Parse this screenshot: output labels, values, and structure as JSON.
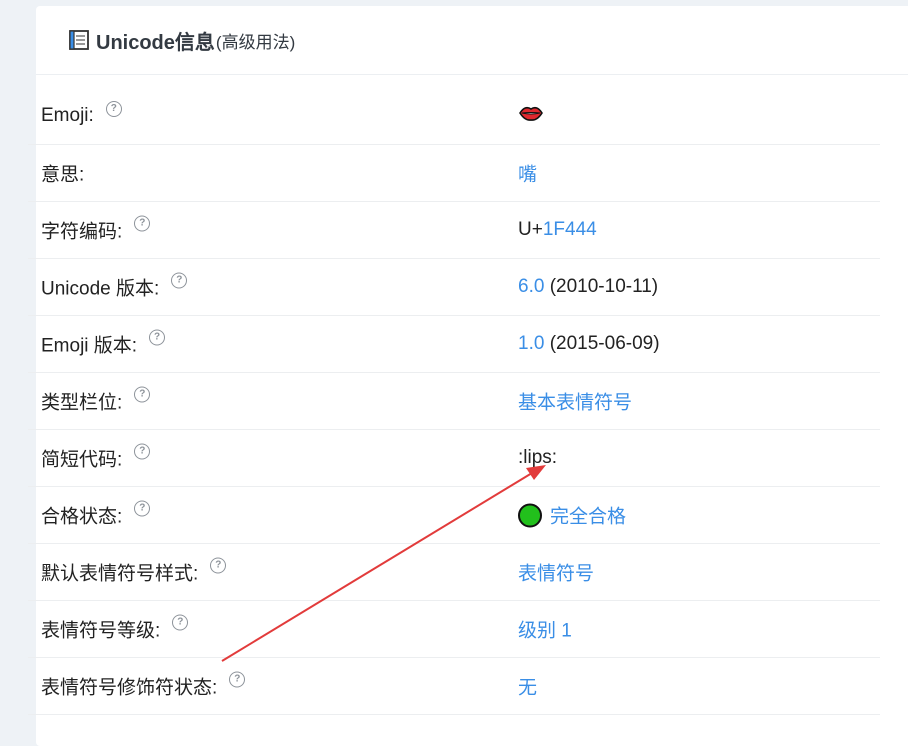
{
  "header": {
    "title": "Unicode信息",
    "subtitle": "(高级用法)",
    "icon": "book-icon"
  },
  "rows": [
    {
      "key": "emoji",
      "label": "Emoji:",
      "help": true,
      "value_type": "emoji",
      "emoji": "👄"
    },
    {
      "key": "meaning",
      "label": "意思:",
      "help": false,
      "value_link": "嘴"
    },
    {
      "key": "codepoint",
      "label": "字符编码:",
      "help": true,
      "value_prefix": "U+",
      "value_link": "1F444"
    },
    {
      "key": "unicode_version",
      "label": "Unicode 版本:",
      "help": true,
      "value_link": "6.0",
      "value_suffix": " (2010-10-11)"
    },
    {
      "key": "emoji_version",
      "label": "Emoji 版本:",
      "help": true,
      "value_link": "1.0",
      "value_suffix": " (2015-06-09)"
    },
    {
      "key": "category",
      "label": "类型栏位:",
      "help": true,
      "value_link": "基本表情符号"
    },
    {
      "key": "shortcode",
      "label": "简短代码:",
      "help": true,
      "value_text": ":lips:"
    },
    {
      "key": "status",
      "label": "合格状态:",
      "help": true,
      "value_link": "完全合格",
      "status_color": "#22c01c"
    },
    {
      "key": "default_style",
      "label": "默认表情符号样式:",
      "help": true,
      "value_link": "表情符号"
    },
    {
      "key": "level",
      "label": "表情符号等级:",
      "help": true,
      "value_link": "级别 1"
    },
    {
      "key": "modifier",
      "label": "表情符号修饰符状态:",
      "help": true,
      "value_link": "无"
    }
  ],
  "help_glyph": "?",
  "colors": {
    "link": "#3a8ee6",
    "annotation_arrow": "#e23b3b"
  }
}
